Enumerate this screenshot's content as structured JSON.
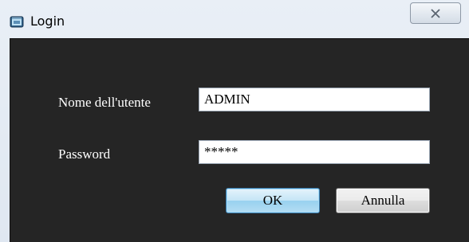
{
  "window": {
    "title": "Login",
    "close_glyph": "✕",
    "icon": "window-app-icon"
  },
  "form": {
    "username_label": "Nome dell'utente",
    "username_value": "ADMIN",
    "password_label": "Password",
    "password_value": "*****"
  },
  "buttons": {
    "ok_label": "OK",
    "cancel_label": "Annulla"
  },
  "colors": {
    "dialog_background": "#252525",
    "titlebar_background": "#dfe7f1",
    "ok_button_accent": "#98d1ef"
  }
}
